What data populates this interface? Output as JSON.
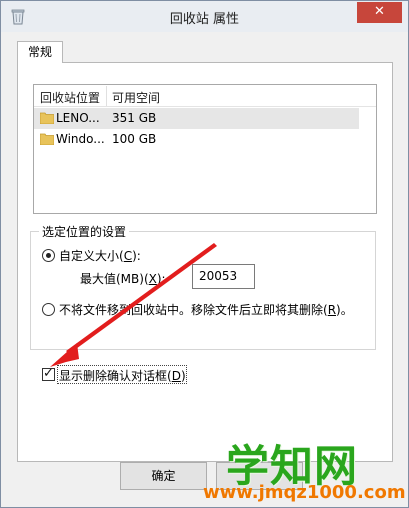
{
  "window": {
    "title": "回收站 属性",
    "close_glyph": "✕"
  },
  "tabs": [
    {
      "label": "常规"
    }
  ],
  "locations": {
    "columns": [
      "回收站位置",
      "可用空间"
    ],
    "rows": [
      {
        "name": "LENO...",
        "space": "351 GB",
        "selected": true
      },
      {
        "name": "Windo...",
        "space": "100 GB",
        "selected": false
      }
    ]
  },
  "settings": {
    "legend": "选定位置的设置",
    "custom_size": {
      "label_prefix": "自定义大小(",
      "hotkey": "C",
      "label_suffix": "):",
      "checked": true
    },
    "max_size": {
      "label_prefix": "最大值(MB)(",
      "hotkey": "X",
      "label_suffix": "):",
      "value": "20053"
    },
    "no_move": {
      "label_prefix": "不将文件移到回收站中。移除文件后立即将其删除(",
      "hotkey": "R",
      "label_suffix": ")。",
      "checked": false
    }
  },
  "confirm_dialog": {
    "label_prefix": "显示删除确认对话框(",
    "hotkey": "D",
    "label_suffix": ")",
    "checked": true
  },
  "buttons": {
    "ok": "确定"
  },
  "watermark": {
    "main": "学知网",
    "url": "www.jmqz1000.com"
  },
  "colors": {
    "annotation_arrow": "#e21d1d",
    "close_button": "#c7463b",
    "watermark_green": "#2aa61d",
    "watermark_orange": "#f07800"
  },
  "icons": {
    "title": "recycle-bin-icon",
    "folder": "folder-icon"
  }
}
